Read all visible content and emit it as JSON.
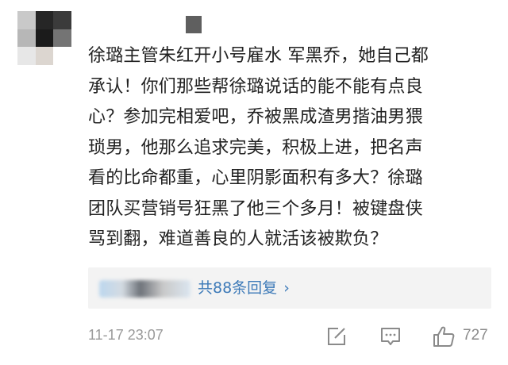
{
  "comment": {
    "lines": [
      "徐璐主管朱红开小号雇水 军黑乔，她自己都",
      "承认！你们那些帮徐璐说话的能不能有点良",
      "心？参加完相爱吧，乔被黑成渣男揩油男猥",
      "琐男，他那么追求完美，积极上进，把名声",
      "看的比命都重，心里阴影面积有多大？徐璐",
      "团队买营销号狂黑了他三个多月！被键盘侠",
      "骂到翻，难道善良的人就活该被欺负？"
    ]
  },
  "replies": {
    "count_label": "共88条回复",
    "chevron": "›"
  },
  "footer": {
    "timestamp": "11-17 23:07",
    "like_count": "727"
  },
  "icons": [
    "avatar",
    "share-icon",
    "comment-icon",
    "like-icon",
    "chevron-right-icon"
  ],
  "colors": {
    "link": "#3d7ab8",
    "meta": "#9a9a9a",
    "text": "#222222",
    "reply_bg": "#f3f3f3"
  }
}
